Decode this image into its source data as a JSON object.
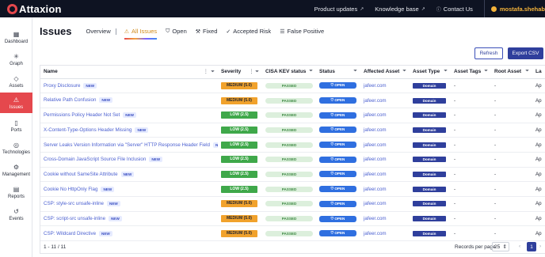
{
  "app": {
    "logo_text": "Attaxion"
  },
  "topnav": {
    "product_updates": "Product updates",
    "knowledge_base": "Knowledge base",
    "contact_us": "Contact Us",
    "user": "mostafa.shehab"
  },
  "sidebar": {
    "items": [
      {
        "label": "Dashboard",
        "icon": "grid-icon"
      },
      {
        "label": "Graph",
        "icon": "graph-icon"
      },
      {
        "label": "Assets",
        "icon": "assets-icon"
      },
      {
        "label": "Issues",
        "icon": "issues-icon",
        "active": true
      },
      {
        "label": "Ports",
        "icon": "ports-icon"
      },
      {
        "label": "Technologies",
        "icon": "tech-icon"
      },
      {
        "label": "Management",
        "icon": "gear-icon"
      },
      {
        "label": "Reports",
        "icon": "reports-icon"
      },
      {
        "label": "Events",
        "icon": "history-icon"
      }
    ]
  },
  "header": {
    "title": "Issues",
    "tabs": [
      {
        "label": "Overview"
      },
      {
        "label": "All Issues",
        "active": true
      },
      {
        "label": "Open"
      },
      {
        "label": "Fixed"
      },
      {
        "label": "Accepted Risk"
      },
      {
        "label": "False Positive"
      }
    ]
  },
  "actions": {
    "refresh": "Refresh",
    "export": "Export CSV"
  },
  "table": {
    "columns": [
      "Name",
      "Severity",
      "CISA KEV status",
      "Status",
      "Affected Asset",
      "Asset Type",
      "Asset Tags",
      "Root Asset",
      "La"
    ],
    "new_label": "NEW",
    "rows": [
      {
        "name": "Proxy Disclosure",
        "severity": "MEDIUM (5.0)",
        "sev_class": "medium",
        "kev": "PASSED",
        "status": "OPEN",
        "asset": "jafeer.com",
        "type": "Domain",
        "tags": "-",
        "root": "-",
        "last": "Ap"
      },
      {
        "name": "Relative Path Confusion",
        "severity": "MEDIUM (5.0)",
        "sev_class": "medium",
        "kev": "PASSED",
        "status": "OPEN",
        "asset": "jafeer.com",
        "type": "Domain",
        "tags": "-",
        "root": "-",
        "last": "Ap"
      },
      {
        "name": "Permissions Policy Header Not Set",
        "severity": "LOW (2.5)",
        "sev_class": "low",
        "kev": "PASSED",
        "status": "OPEN",
        "asset": "jafeer.com",
        "type": "Domain",
        "tags": "-",
        "root": "-",
        "last": "Ap"
      },
      {
        "name": "X-Content-Type-Options Header Missing",
        "severity": "LOW (2.5)",
        "sev_class": "low",
        "kev": "PASSED",
        "status": "OPEN",
        "asset": "jafeer.com",
        "type": "Domain",
        "tags": "-",
        "root": "-",
        "last": "Ap"
      },
      {
        "name": "Server Leaks Version Information via \"Server\" HTTP Response Header Field",
        "severity": "LOW (2.5)",
        "sev_class": "low",
        "kev": "PASSED",
        "status": "OPEN",
        "asset": "jafeer.com",
        "type": "Domain",
        "tags": "-",
        "root": "-",
        "last": "Ap"
      },
      {
        "name": "Cross-Domain JavaScript Source File Inclusion",
        "severity": "LOW (2.5)",
        "sev_class": "low",
        "kev": "PASSED",
        "status": "OPEN",
        "asset": "jafeer.com",
        "type": "Domain",
        "tags": "-",
        "root": "-",
        "last": "Ap"
      },
      {
        "name": "Cookie without SameSite Attribute",
        "severity": "LOW (2.5)",
        "sev_class": "low",
        "kev": "PASSED",
        "status": "OPEN",
        "asset": "jafeer.com",
        "type": "Domain",
        "tags": "-",
        "root": "-",
        "last": "Ap"
      },
      {
        "name": "Cookie No HttpOnly Flag",
        "severity": "LOW (2.5)",
        "sev_class": "low",
        "kev": "PASSED",
        "status": "OPEN",
        "asset": "jafeer.com",
        "type": "Domain",
        "tags": "-",
        "root": "-",
        "last": "Ap"
      },
      {
        "name": "CSP: style-src unsafe-inline",
        "severity": "MEDIUM (5.0)",
        "sev_class": "medium",
        "kev": "PASSED",
        "status": "OPEN",
        "asset": "jafeer.com",
        "type": "Domain",
        "tags": "-",
        "root": "-",
        "last": "Ap"
      },
      {
        "name": "CSP: script-src unsafe-inline",
        "severity": "MEDIUM (5.0)",
        "sev_class": "medium",
        "kev": "PASSED",
        "status": "OPEN",
        "asset": "jafeer.com",
        "type": "Domain",
        "tags": "-",
        "root": "-",
        "last": "Ap"
      },
      {
        "name": "CSP: Wildcard Directive",
        "severity": "MEDIUM (5.0)",
        "sev_class": "medium",
        "kev": "PASSED",
        "status": "OPEN",
        "asset": "jafeer.com",
        "type": "Domain",
        "tags": "-",
        "root": "-",
        "last": "Ap"
      }
    ]
  },
  "footer": {
    "records": "1 - 11 / 11",
    "records_per_page_label": "Records per page",
    "records_per_page": "25",
    "current_page": "1"
  },
  "colors": {
    "topbar": "#0e1322",
    "accent": "#e5484d",
    "primary": "#2f3f9c",
    "medium": "#f1a22c",
    "low": "#3fa84a",
    "open": "#2f6fe0",
    "username": "#f3b23a"
  }
}
